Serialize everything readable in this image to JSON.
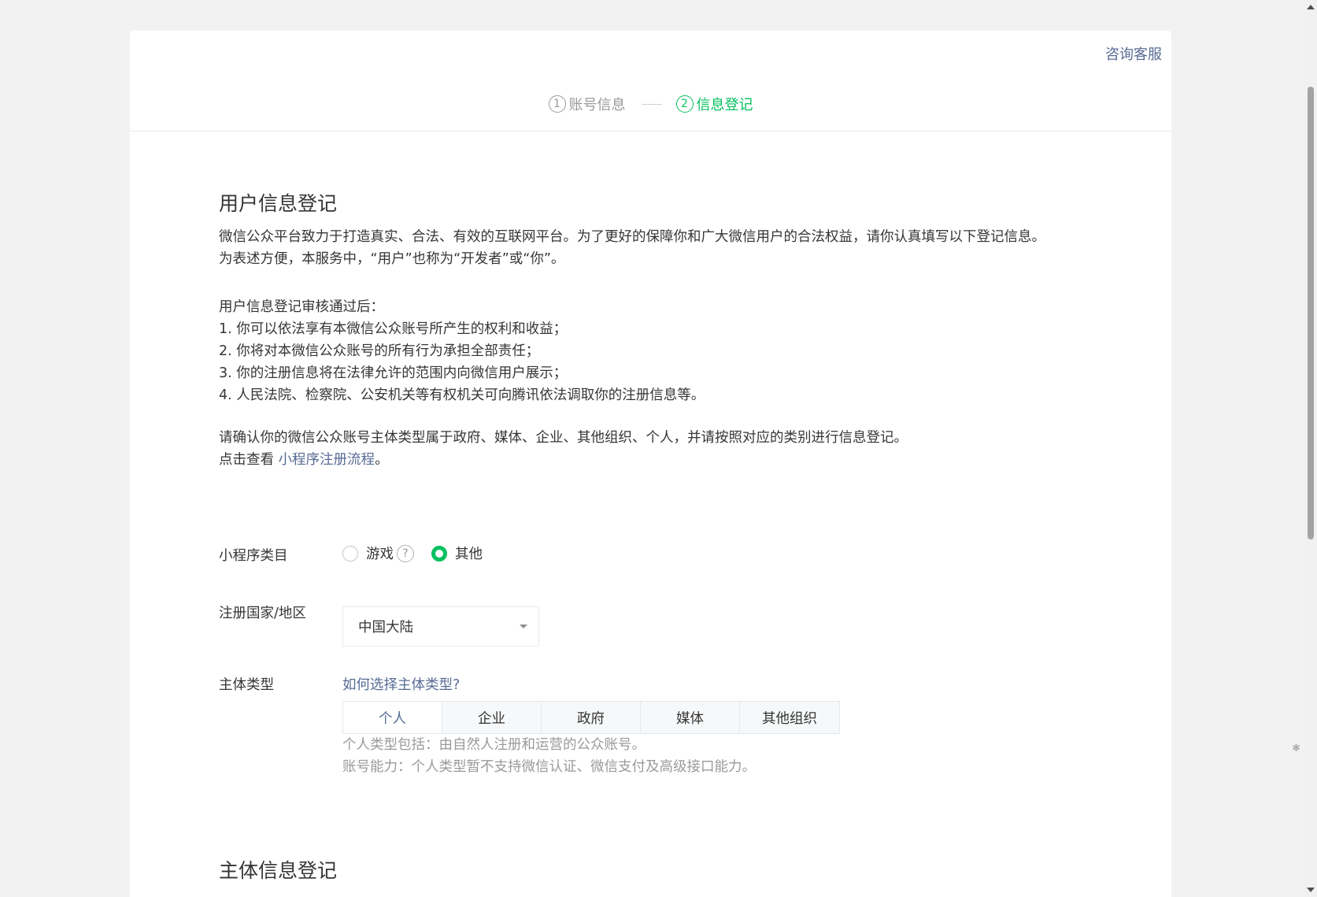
{
  "header": {
    "help_link": "咨询客服",
    "steps": [
      {
        "num": "1",
        "label": "账号信息"
      },
      {
        "num": "2",
        "label": "信息登记"
      }
    ]
  },
  "user_section": {
    "title": "用户信息登记",
    "intro_line1": "微信公众平台致力于打造真实、合法、有效的互联网平台。为了更好的保障你和广大微信用户的合法权益，请你认真填写以下登记信息。",
    "intro_line2": "为表述方便，本服务中，“用户”也称为“开发者”或“你”。",
    "after_title": "用户信息登记审核通过后：",
    "after_items": [
      "1. 你可以依法享有本微信公众账号所产生的权利和收益；",
      "2. 你将对本微信公众账号的所有行为承担全部责任；",
      "3. 你的注册信息将在法律允许的范围内向微信用户展示；",
      "4. 人民法院、检察院、公安机关等有权机关可向腾讯依法调取你的注册信息等。"
    ],
    "confirm_line": "请确认你的微信公众账号主体类型属于政府、媒体、企业、其他组织、个人，并请按照对应的类别进行信息登记。",
    "click_prefix": "点击查看 ",
    "click_link": "小程序注册流程",
    "click_suffix": "。"
  },
  "form": {
    "category_label": "小程序类目",
    "category_options": [
      {
        "label": "游戏",
        "checked": false
      },
      {
        "label": "其他",
        "checked": true
      }
    ],
    "country_label": "注册国家/地区",
    "country_value": "中国大陆",
    "subject_label": "主体类型",
    "subject_help_link": "如何选择主体类型?",
    "subject_tabs": [
      "个人",
      "企业",
      "政府",
      "媒体",
      "其他组织"
    ],
    "subject_active": "个人",
    "subject_desc_line1": "个人类型包括：由自然人注册和运营的公众账号。",
    "subject_desc_line2": "账号能力：个人类型暂不支持微信认证、微信支付及高级接口能力。"
  },
  "subject_section": {
    "title": "主体信息登记"
  },
  "colors": {
    "accent_green": "#07c160",
    "link_blue": "#576b95",
    "muted_gray": "#9a9a9a"
  }
}
